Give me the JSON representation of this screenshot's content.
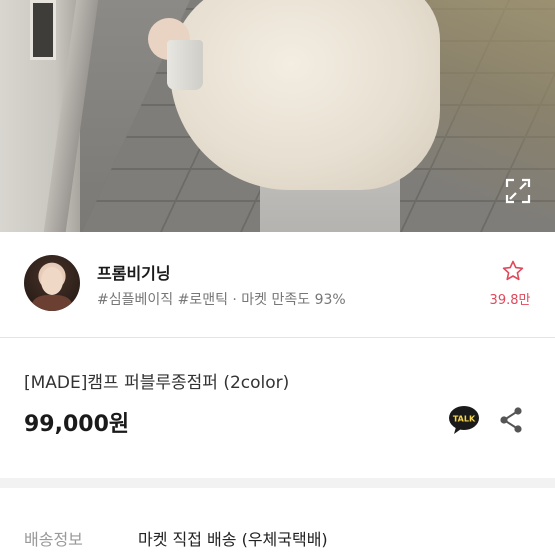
{
  "hero": {
    "expand_icon": "expand-icon"
  },
  "seller": {
    "name": "프롬비기닝",
    "tags": "#심플베이직 #로맨틱 · 마켓 만족도 93%",
    "favorite_icon": "star-outline-icon",
    "favorite_count": "39.8만",
    "accent_color": "#e0485b"
  },
  "product": {
    "title": "[MADE]캠프 퍼블루종점퍼 (2color)",
    "price": "99,000원",
    "talk_icon": "kakao-talk-icon",
    "talk_label": "TALK",
    "share_icon": "share-icon"
  },
  "delivery": {
    "label": "배송정보",
    "value": "마켓 직접 배송 (우체국택배)"
  }
}
